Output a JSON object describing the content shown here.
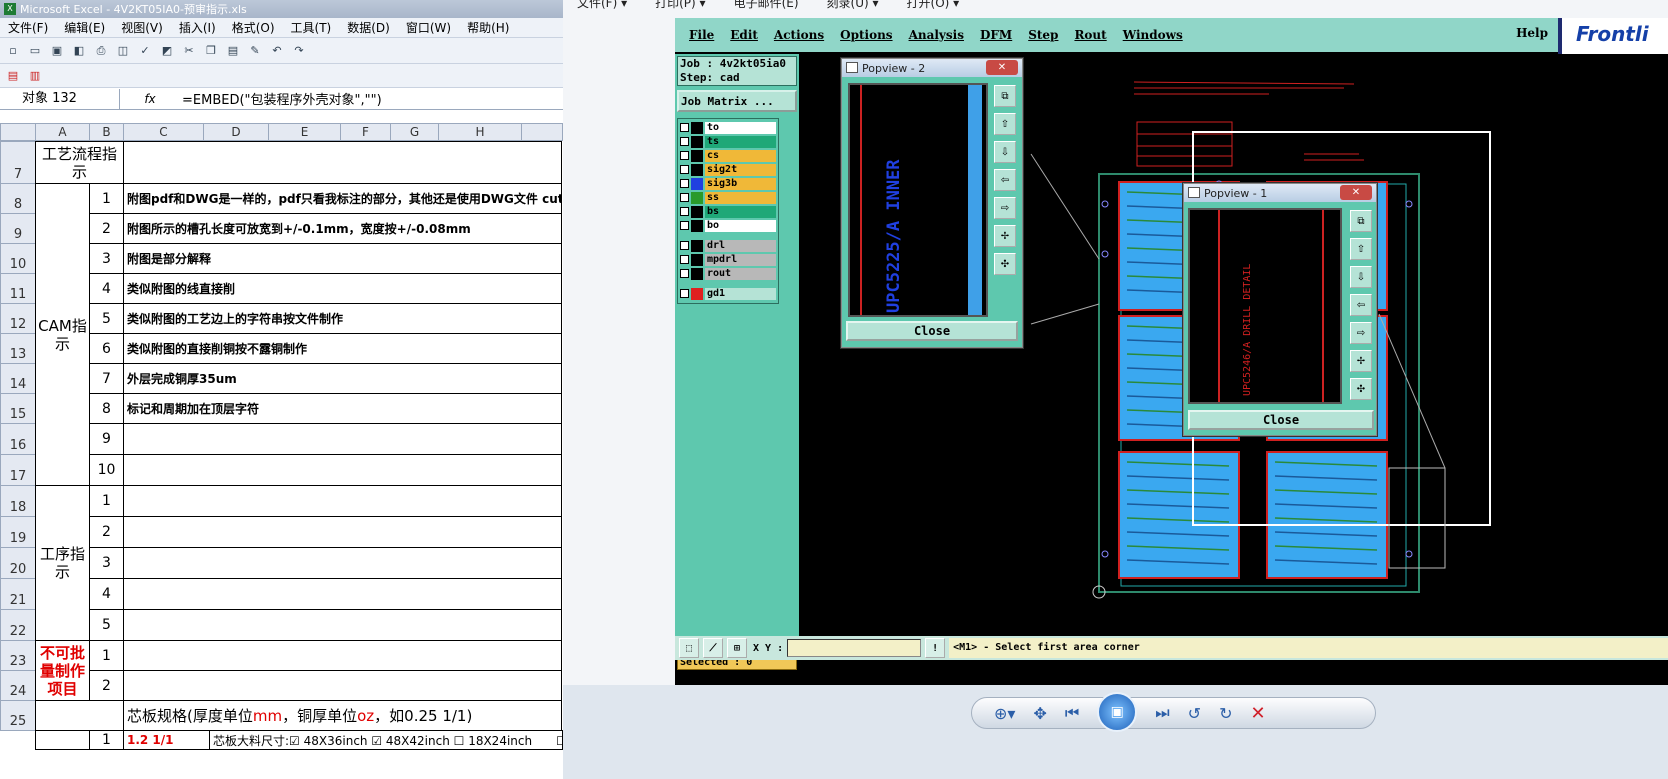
{
  "excel": {
    "title": "Microsoft Excel - 4V2KT05IA0-预审指示.xls",
    "menu": [
      "文件(F)",
      "编辑(E)",
      "视图(V)",
      "插入(I)",
      "格式(O)",
      "工具(T)",
      "数据(D)",
      "窗口(W)",
      "帮助(H)"
    ],
    "name_box": "对象 132",
    "fx": "fx",
    "formula": "=EMBED(\"包装程序外壳对象\",\"\")",
    "columns": [
      "A",
      "B",
      "C",
      "D",
      "E",
      "F",
      "G",
      "H"
    ],
    "row_numbers": [
      "7",
      "8",
      "9",
      "10",
      "11",
      "12",
      "13",
      "14",
      "15",
      "16",
      "17",
      "18",
      "19",
      "20",
      "21",
      "22",
      "23",
      "24",
      "25"
    ],
    "section_flow": "工艺流程指示",
    "section_cam": "CAM指示",
    "section_process": "工序指示",
    "section_nobatch": "不可批量制作项目",
    "cam_rows": [
      {
        "n": "1",
        "text": "附图pdf和DWG是一样的，pdf只看我标注的部分，其他还是使用DWG文件 cut，通v-cut"
      },
      {
        "n": "2",
        "text": "附图所示的槽孔长度可放宽到+/-0.1mm，宽度按+/-0.08mm"
      },
      {
        "n": "3",
        "text": "附图是部分解释"
      },
      {
        "n": "4",
        "text": "类似附图的线直接削"
      },
      {
        "n": "5",
        "text": "类似附图的工艺边上的字符串按文件制作"
      },
      {
        "n": "6",
        "text": "类似附图的直接削铜按不露铜制作"
      },
      {
        "n": "7",
        "text": "外层完成铜厚35um"
      },
      {
        "n": "8",
        "text": "标记和周期加在顶层字符"
      },
      {
        "n": "9",
        "text": ""
      },
      {
        "n": "10",
        "text": ""
      }
    ],
    "process_rows": [
      "1",
      "2",
      "3",
      "4",
      "5"
    ],
    "nobatch_rows": [
      "1",
      "2"
    ],
    "row25_text_a": "芯板规格(厚度单位",
    "row25_mm": "mm",
    "row25_text_b": "，铜厚单位",
    "row25_oz": "oz",
    "row25_text_c": "，如0.25 1/1)",
    "row26_num": "1",
    "row26_val": "1.2 1/1",
    "row26_label": "芯板大料尺寸:☑ 48X36inch ☑ 48X42inch ☐ 18X24inch",
    "row26_tail": "☐ 待购"
  },
  "viewer": {
    "menu": [
      "文件(F) ▾",
      "打印(P) ▾",
      "电子邮件(E)",
      "刻录(U) ▾",
      "打开(O) ▾"
    ]
  },
  "frontline": {
    "menu": [
      "File",
      "Edit",
      "Actions",
      "Options",
      "Analysis",
      "DFM",
      "Step",
      "Rout",
      "Windows"
    ],
    "help": "Help",
    "logo": "Frontli",
    "job_label": "Job : 4v2kt05ia0",
    "step_label": "Step: cad",
    "job_matrix": "Job Matrix ...",
    "layers": [
      {
        "name": "to",
        "color": "#ffffff",
        "sw": "#000000"
      },
      {
        "name": "ts",
        "color": "#1fa878",
        "sw": "#000000"
      },
      {
        "name": "cs",
        "color": "#f0b838",
        "sw": "#000000"
      },
      {
        "name": "sig2t",
        "color": "#f0b838",
        "sw": "#000000"
      },
      {
        "name": "sig3b",
        "color": "#f0b838",
        "sw": "#2040e0"
      },
      {
        "name": "ss",
        "color": "#f0b838",
        "sw": "#2a9a2a"
      },
      {
        "name": "bs",
        "color": "#1fa878",
        "sw": "#000000"
      },
      {
        "name": "bo",
        "color": "#ffffff",
        "sw": "#000000"
      },
      {
        "name": "drl",
        "color": "#b8b8b8",
        "sw": "#000000"
      },
      {
        "name": "mpdrl",
        "color": "#b8b8b8",
        "sw": "#000000"
      },
      {
        "name": "rout",
        "color": "#b8b8b8",
        "sw": "#000000"
      },
      {
        "name": "gd1",
        "color": "#b5e3d6",
        "sw": "#e02020"
      }
    ],
    "selected": "Selected : 0",
    "xy_label": "X Y :",
    "status": "<M1> - Select first area corner",
    "popview2_title": "Popview - 2",
    "popview1_title": "Popview - 1",
    "close_label": "Close",
    "popview2_text": "UPC5225/A INNER",
    "popview1_text": "UPC5246/A DRILL DETAIL"
  }
}
